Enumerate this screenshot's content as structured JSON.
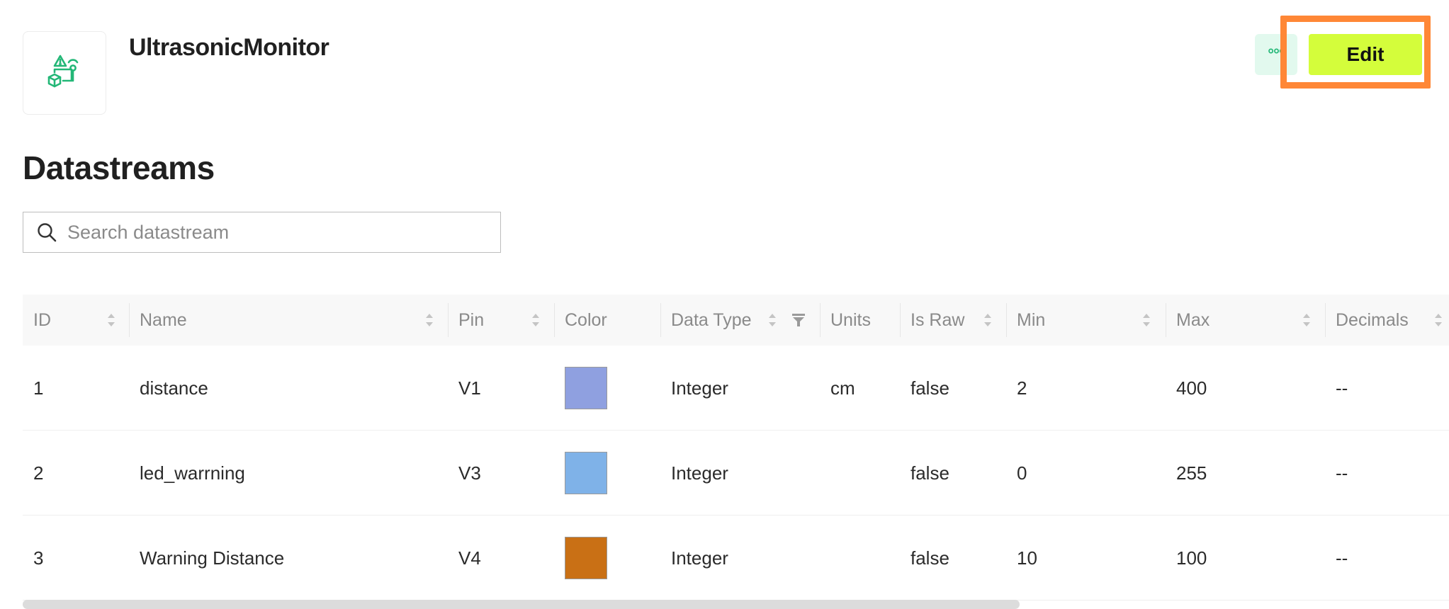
{
  "product": {
    "name": "UltrasonicMonitor",
    "logo_icon": "device-template-icon"
  },
  "header": {
    "more_label": "°°°",
    "edit_label": "Edit"
  },
  "section": {
    "title": "Datastreams"
  },
  "search": {
    "placeholder": "Search datastream",
    "value": ""
  },
  "colors": {
    "accent": "#d4fd3b",
    "highlight": "#ff8736",
    "brand_green": "#23b777"
  },
  "table": {
    "columns": [
      {
        "key": "id",
        "label": "ID"
      },
      {
        "key": "name",
        "label": "Name"
      },
      {
        "key": "pin",
        "label": "Pin"
      },
      {
        "key": "color",
        "label": "Color"
      },
      {
        "key": "data_type",
        "label": "Data Type"
      },
      {
        "key": "units",
        "label": "Units"
      },
      {
        "key": "is_raw",
        "label": "Is Raw"
      },
      {
        "key": "min",
        "label": "Min"
      },
      {
        "key": "max",
        "label": "Max"
      },
      {
        "key": "decimals",
        "label": "Decimals"
      }
    ],
    "rows": [
      {
        "id": "1",
        "name": "distance",
        "pin": "V1",
        "color": "#8fa0e0",
        "data_type": "Integer",
        "units": "cm",
        "is_raw": "false",
        "min": "2",
        "max": "400",
        "decimals": "--"
      },
      {
        "id": "2",
        "name": "led_warrning",
        "pin": "V3",
        "color": "#7fb2e8",
        "data_type": "Integer",
        "units": "",
        "is_raw": "false",
        "min": "0",
        "max": "255",
        "decimals": "--"
      },
      {
        "id": "3",
        "name": "Warning Distance",
        "pin": "V4",
        "color": "#c97015",
        "data_type": "Integer",
        "units": "",
        "is_raw": "false",
        "min": "10",
        "max": "100",
        "decimals": "--"
      }
    ]
  }
}
